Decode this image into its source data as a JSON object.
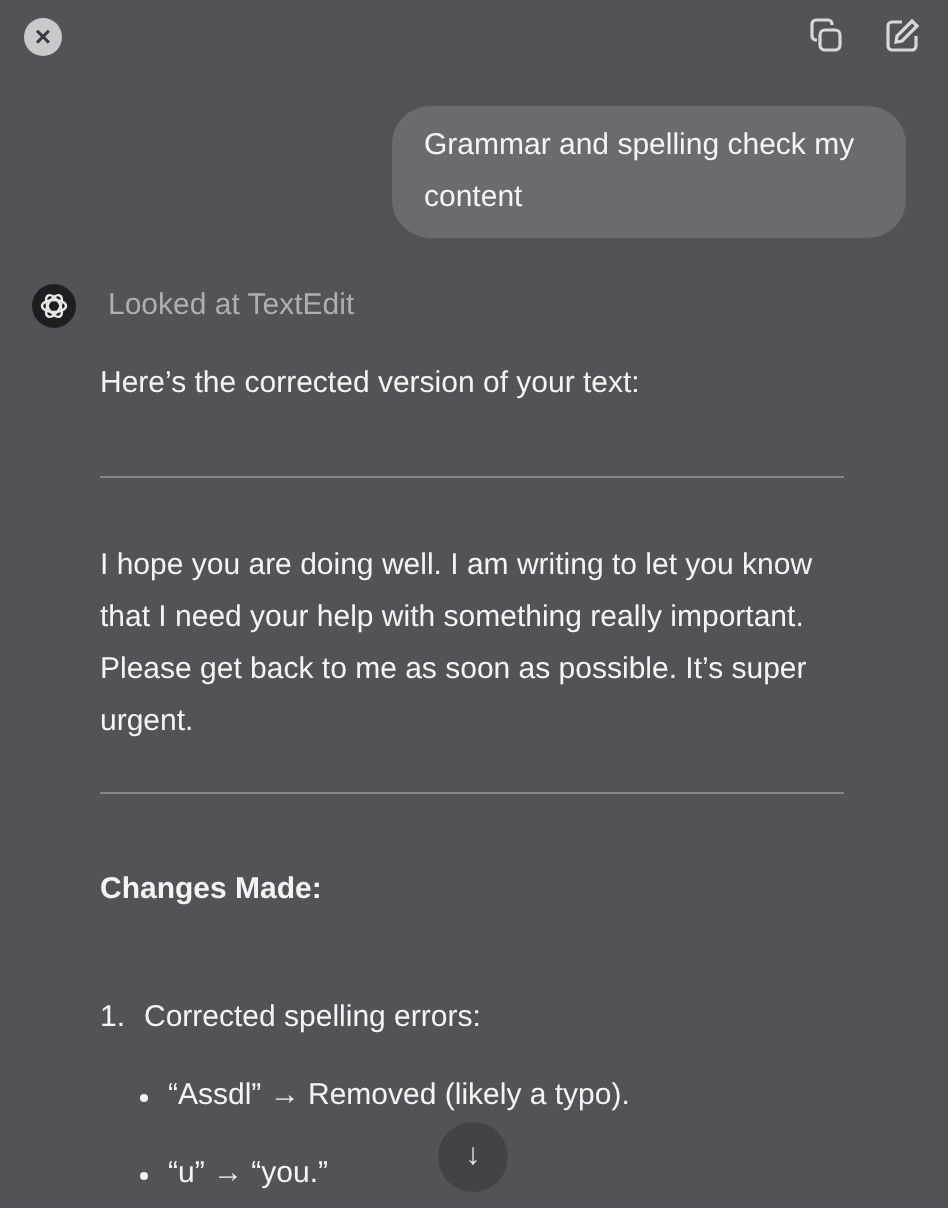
{
  "toolbar": {
    "close": "×"
  },
  "user_message": "Grammar and spelling check my content",
  "assistant": {
    "status": "Looked at TextEdit",
    "intro": "Here’s the corrected version of your text:",
    "corrected_text": "I hope you are doing well. I am writing to let you know that I need your help with something really important. Please get back to me as soon as possible. It’s super urgent.",
    "heading": "Changes Made:",
    "changes": [
      {
        "number": "1.",
        "text": "Corrected spelling errors:",
        "items": [
          "“Assdl” → Removed (likely a typo).",
          "“u” → “you.”"
        ]
      }
    ]
  },
  "scroll_button": "↓"
}
